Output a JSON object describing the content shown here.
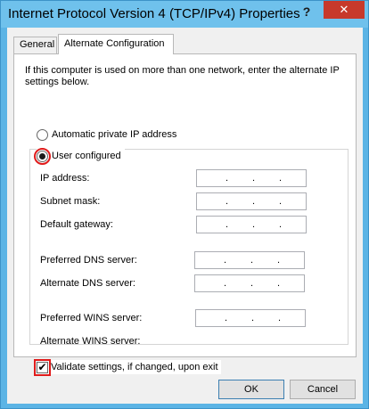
{
  "window": {
    "title": "Internet Protocol Version 4 (TCP/IPv4) Properties",
    "help_label": "?",
    "close_label": "✕"
  },
  "tabs": [
    {
      "label": "General",
      "selected": false
    },
    {
      "label": "Alternate Configuration",
      "selected": true
    }
  ],
  "panel": {
    "description": "If this computer is used on more than one network, enter the alternate IP settings below.",
    "options": [
      {
        "label": "Automatic private IP address",
        "checked": false
      },
      {
        "label": "User configured",
        "checked": true
      }
    ],
    "fields": [
      {
        "label": "IP address:",
        "value": ". . ."
      },
      {
        "label": "Subnet mask:",
        "value": ". . ."
      },
      {
        "label": "Default gateway:",
        "value": ". . ."
      },
      {
        "label": "Preferred DNS server:",
        "value": ". . ."
      },
      {
        "label": "Alternate DNS server:",
        "value": ". . ."
      },
      {
        "label": "Preferred WINS server:",
        "value": ". . ."
      },
      {
        "label": "Alternate WINS server:",
        "value": ". . ."
      }
    ],
    "validate": {
      "label": "Validate settings, if changed, upon exit",
      "checked": true
    }
  },
  "buttons": {
    "ok": "OK",
    "cancel": "Cancel"
  },
  "colors": {
    "highlight": "#e01b1b",
    "close": "#c7392b",
    "title_bar": "#6fc1ec"
  }
}
